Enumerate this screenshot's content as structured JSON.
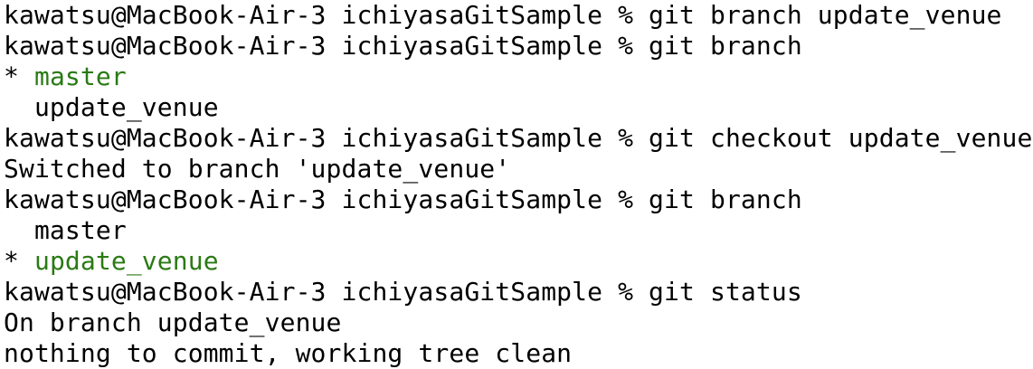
{
  "colors": {
    "background": "#ffffff",
    "text": "#000000",
    "current_branch": "#2a7a14"
  },
  "terminal": {
    "lines": [
      {
        "text": "kawatsu@MacBook-Air-3 ichiyasaGitSample % git branch update_venue"
      },
      {
        "text": "kawatsu@MacBook-Air-3 ichiyasaGitSample % git branch"
      },
      {
        "prefix": "* ",
        "text": "master"
      },
      {
        "text": "  update_venue"
      },
      {
        "text": "kawatsu@MacBook-Air-3 ichiyasaGitSample % git checkout update_venue"
      },
      {
        "text": "Switched to branch 'update_venue'"
      },
      {
        "text": "kawatsu@MacBook-Air-3 ichiyasaGitSample % git branch"
      },
      {
        "text": "  master"
      },
      {
        "prefix": "* ",
        "text": "update_venue"
      },
      {
        "text": "kawatsu@MacBook-Air-3 ichiyasaGitSample % git status"
      },
      {
        "text": "On branch update_venue"
      },
      {
        "text": "nothing to commit, working tree clean"
      }
    ]
  }
}
